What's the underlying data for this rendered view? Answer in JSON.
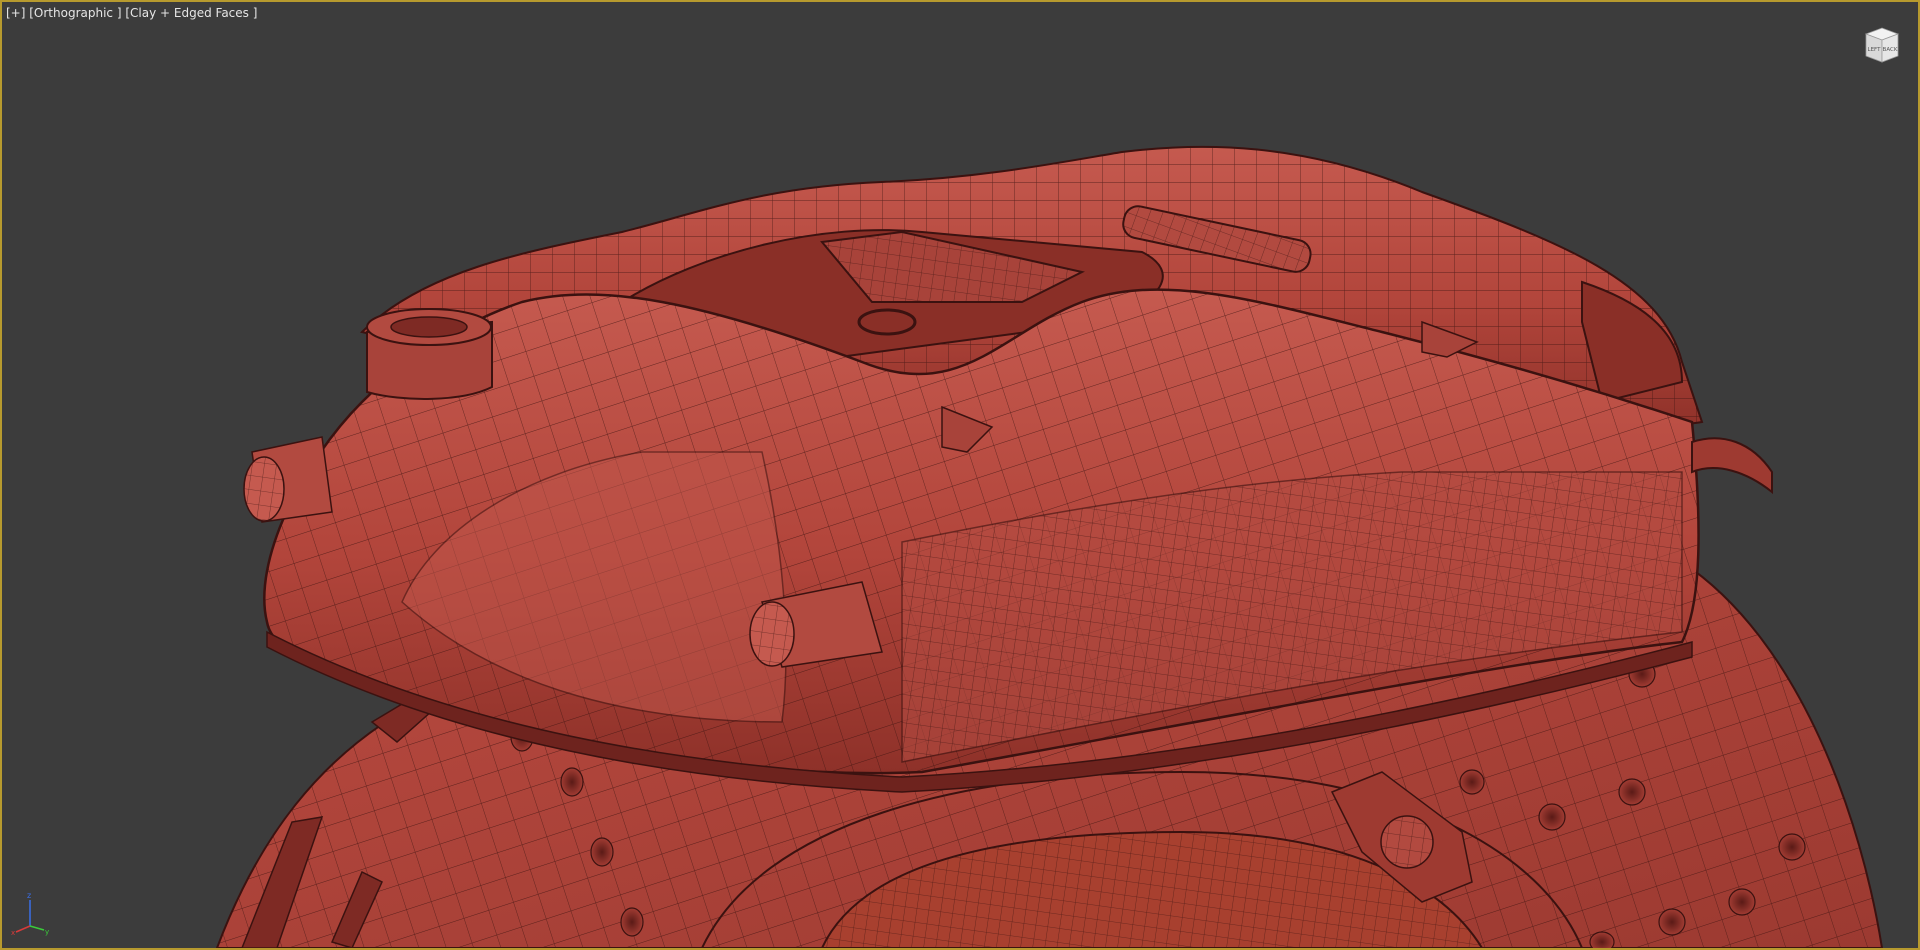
{
  "viewport": {
    "menu_plus": "[+]",
    "view_mode": "[Orthographic ]",
    "shading_mode": "[Clay + Edged Faces ]",
    "active": true
  },
  "view_cube": {
    "face_left": "LEFT",
    "face_front": "BACK"
  },
  "axis_gizmo": {
    "z": "z",
    "x": "x",
    "y": "y"
  },
  "colors": {
    "background": "#3c3c3c",
    "viewport_border": "#b79a2e",
    "model_base": "#b6473d",
    "model_dark": "#7e2a24",
    "wire": "#3b1210"
  },
  "scene": {
    "object": "brake caliper and drilled rotor, clay shaded with edged faces"
  }
}
